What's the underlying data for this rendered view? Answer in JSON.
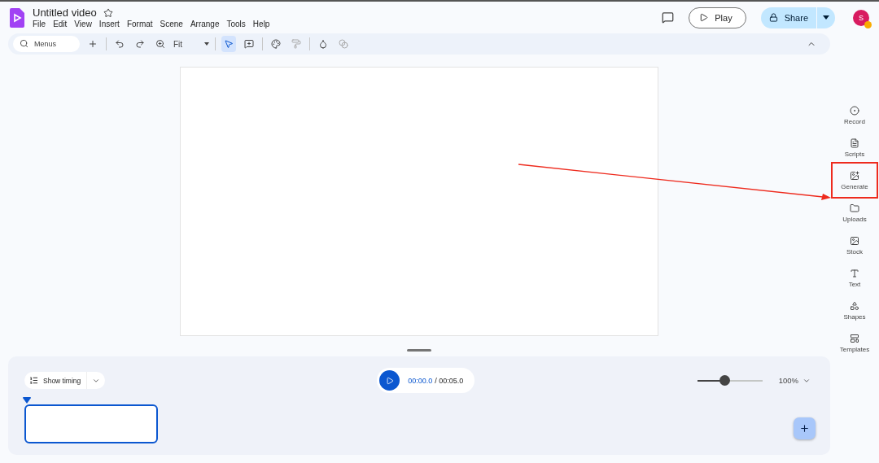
{
  "document": {
    "title": "Untitled video",
    "starred": false
  },
  "menu": [
    "File",
    "Edit",
    "View",
    "Insert",
    "Format",
    "Scene",
    "Arrange",
    "Tools",
    "Help"
  ],
  "header": {
    "play": "Play",
    "share": "Share",
    "avatar": "S"
  },
  "toolbar": {
    "search_placeholder": "Menus",
    "zoom": "Fit"
  },
  "side_panel": [
    {
      "kind": "record",
      "label": "Record",
      "highlighted": false
    },
    {
      "kind": "scripts",
      "label": "Scripts",
      "highlighted": false
    },
    {
      "kind": "generate",
      "label": "Generate",
      "highlighted": true
    },
    {
      "kind": "uploads",
      "label": "Uploads",
      "highlighted": false
    },
    {
      "kind": "stock",
      "label": "Stock",
      "highlighted": false
    },
    {
      "kind": "text",
      "label": "Text",
      "highlighted": false
    },
    {
      "kind": "shapes",
      "label": "Shapes",
      "highlighted": false
    },
    {
      "kind": "templates",
      "label": "Templates",
      "highlighted": false
    }
  ],
  "timeline": {
    "show_timing": "Show timing",
    "current_time": "00:00.0",
    "total_time": "/ 00:05.0",
    "zoom": {
      "level": 0.42,
      "reading": "100%"
    }
  }
}
